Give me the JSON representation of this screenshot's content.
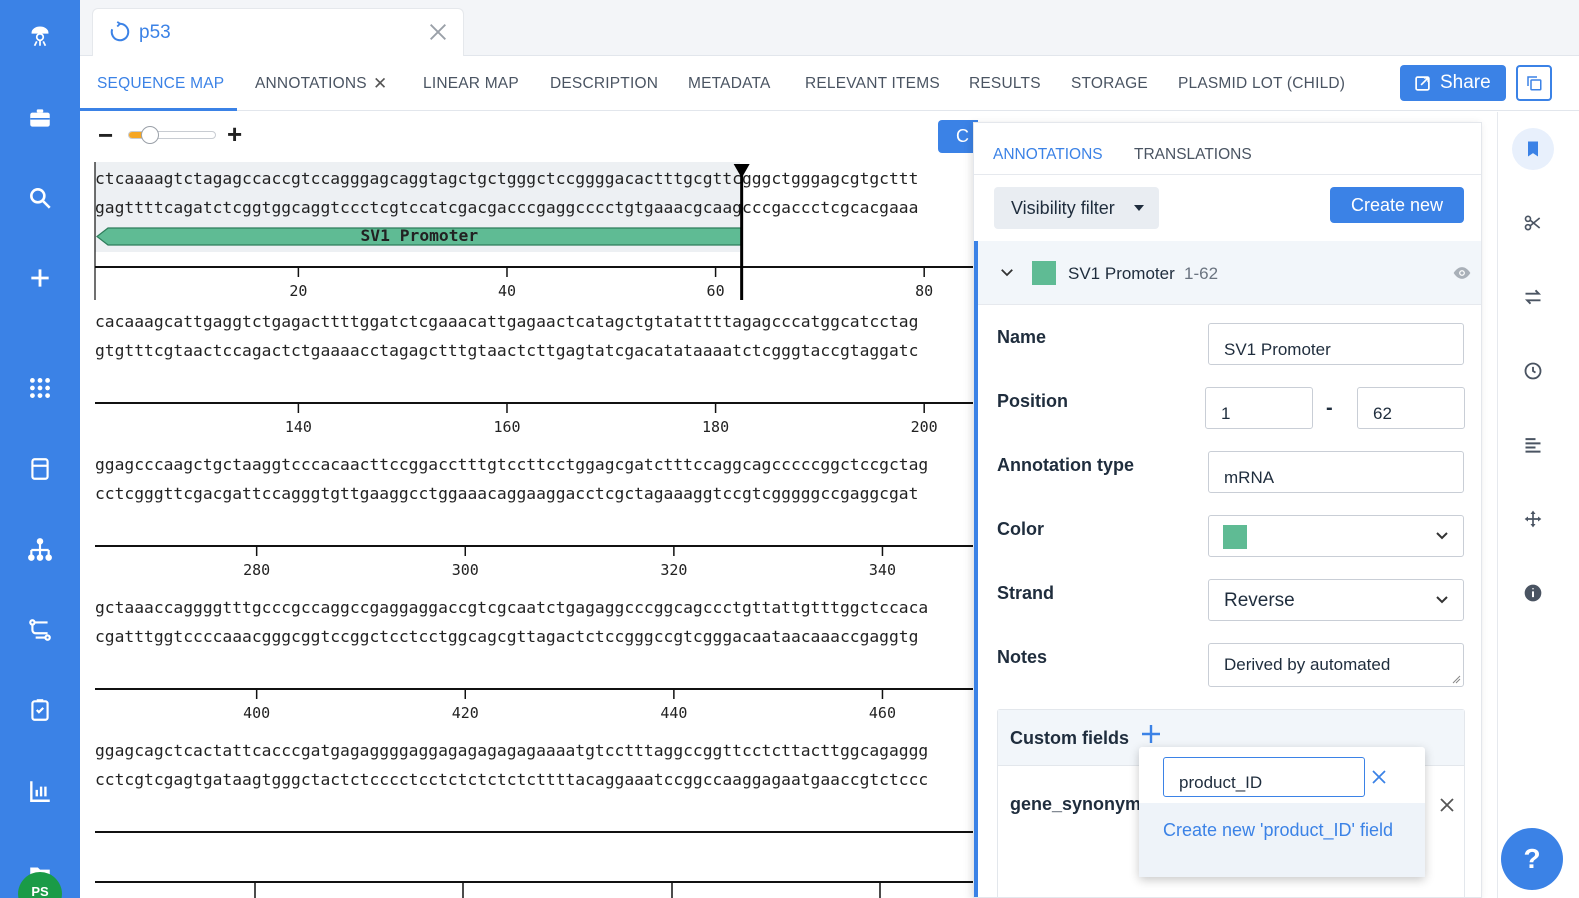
{
  "document": {
    "title": "p53"
  },
  "nav": {
    "tabs": [
      {
        "label": "SEQUENCE MAP"
      },
      {
        "label": "ANNOTATIONS"
      },
      {
        "label": "LINEAR MAP"
      },
      {
        "label": "DESCRIPTION"
      },
      {
        "label": "METADATA"
      },
      {
        "label": "RELEVANT ITEMS"
      },
      {
        "label": "RESULTS"
      },
      {
        "label": "STORAGE"
      },
      {
        "label": "PLASMID LOT (CHILD)"
      }
    ],
    "share_label": "Share"
  },
  "toolbar": {
    "zoom_minus": "−",
    "zoom_plus": "+",
    "create_peek": "C",
    "zoom_level": 0.25
  },
  "sequence": {
    "rows": [
      {
        "top": "ctcaaaagtctagagccaccgtccagggagcaggtagctgctgggctccggggacactttgcgttcgggctgggagcgtgcttt",
        "bottom": "gagttttcagatctcggtggcaggtccctcgtccatcgacgacccgaggcccctgtgaaacgcaagcccgaccctcgcacgaaa",
        "ticks": [
          "20",
          "40",
          "60",
          "80"
        ]
      },
      {
        "top": "cacaaagcattgaggtctgagacttttggatctcgaaacattgagaactcatagctgtatattttagagcccatggcatcctag",
        "bottom": "gtgtttcgtaactccagactctgaaaacctagagctttgtaactcttgagtatcgacatataaaatctcgggtaccgtaggatc",
        "ticks": [
          "140",
          "160",
          "180",
          "200"
        ]
      },
      {
        "top": "ggagcccaagctgctaaggtcccacaacttccggacctttgtccttcctggagcgatctttccaggcagcccccggctccgctag",
        "bottom": "cctcgggttcgacgattccagggtgttgaaggcctggaaacaggaaggacctcgctagaaaggtccgtcgggggccgaggcgat",
        "ticks": [
          "280",
          "300",
          "320",
          "340"
        ]
      },
      {
        "top": "gctaaaccaggggtttgcccgccaggccgaggaggaccgtcgcaatctgagaggcccggcagccctgttattgtttggctccaca",
        "bottom": "cgatttggtccccaaacgggcggtccggctcctcctggcagcgttagactctccgggccgtcgggacaataacaaaccgaggtg",
        "ticks": [
          "400",
          "420",
          "440",
          "460"
        ]
      },
      {
        "top": "ggagcagctcactattcacccgatgagaggggaggagagagagagaaaatgtcctttaggccggttcctcttacttggcagaggg",
        "bottom": "cctcgtcgagtgataagtgggctactctcccctcctctctctctcttttacaggaaatccggccaaggagaatgaaccgtctccc",
        "ticks": []
      }
    ],
    "feature_label": "SV1 Promoter",
    "feature_color": "#5fbb94"
  },
  "panel": {
    "tabs": {
      "annotations": "ANNOTATIONS",
      "translations": "TRANSLATIONS"
    },
    "visibility_filter": "Visibility filter",
    "create_new": "Create new",
    "annotation": {
      "name": "SV1 Promoter",
      "range": "1-62",
      "color": "#5fbb94",
      "fields": {
        "name_label": "Name",
        "name_value": "SV1 Promoter",
        "position_label": "Position",
        "position_start": "1",
        "position_end": "62",
        "type_label": "Annotation type",
        "type_value": "mRNA",
        "color_label": "Color",
        "strand_label": "Strand",
        "strand_value": "Reverse",
        "notes_label": "Notes",
        "notes_value": "Derived by automated"
      },
      "custom_fields": {
        "title": "Custom fields",
        "items": [
          {
            "name": "gene_synonym"
          }
        ]
      }
    }
  },
  "popup": {
    "input_value": "product_ID",
    "option_label": "Create new 'product_ID' field"
  },
  "user": {
    "initials": "PS"
  },
  "help": {
    "label": "?"
  },
  "colors": {
    "accent": "#3b82e6",
    "rail": "#3b82e6",
    "zoom": "#f5a623"
  }
}
